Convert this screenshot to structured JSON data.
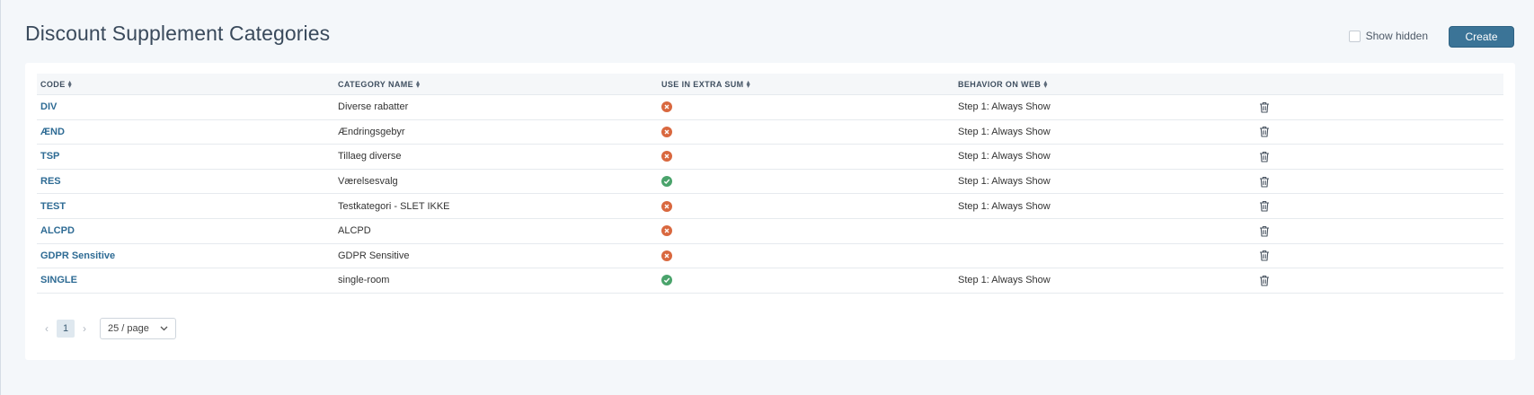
{
  "page": {
    "title": "Discount Supplement Categories",
    "show_hidden_label": "Show hidden",
    "create_label": "Create"
  },
  "table": {
    "columns": [
      {
        "key": "code",
        "label": "CODE"
      },
      {
        "key": "name",
        "label": "CATEGORY NAME"
      },
      {
        "key": "extra",
        "label": "USE IN EXTRA SUM"
      },
      {
        "key": "web",
        "label": "BEHAVIOR ON WEB"
      }
    ],
    "rows": [
      {
        "code": "DIV",
        "name": "Diverse rabatter",
        "use_in_extra_sum": false,
        "behavior": "Step 1: Always Show"
      },
      {
        "code": "ÆND",
        "name": "Ændringsgebyr",
        "use_in_extra_sum": false,
        "behavior": "Step 1: Always Show"
      },
      {
        "code": "TSP",
        "name": "Tillaeg diverse",
        "use_in_extra_sum": false,
        "behavior": "Step 1: Always Show"
      },
      {
        "code": "RES",
        "name": "Værelsesvalg",
        "use_in_extra_sum": true,
        "behavior": "Step 1: Always Show"
      },
      {
        "code": "TEST",
        "name": "Testkategori - SLET IKKE",
        "use_in_extra_sum": false,
        "behavior": "Step 1: Always Show"
      },
      {
        "code": "ALCPD",
        "name": "ALCPD",
        "use_in_extra_sum": false,
        "behavior": ""
      },
      {
        "code": "GDPR Sensitive",
        "name": "GDPR Sensitive",
        "use_in_extra_sum": false,
        "behavior": ""
      },
      {
        "code": "SINGLE",
        "name": "single-room",
        "use_in_extra_sum": true,
        "behavior": "Step 1: Always Show"
      }
    ]
  },
  "pagination": {
    "prev": "‹",
    "current_page": "1",
    "next": "›",
    "page_size": "25 / page"
  },
  "colors": {
    "accent": "#3b7497",
    "link": "#2e6b94",
    "status_no": "#d9683f",
    "status_yes": "#4aa36b"
  }
}
